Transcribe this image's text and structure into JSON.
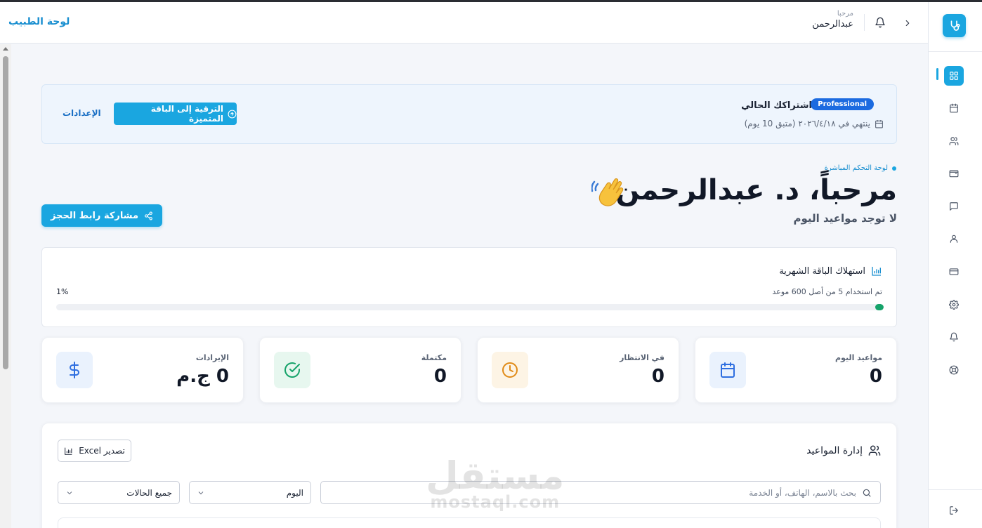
{
  "header": {
    "title": "لوحة الطبيب",
    "greeting": "مرحبا",
    "user_name": "عبدالرحمن"
  },
  "subscription": {
    "label": "اشتراكك الحالي",
    "plan_badge": "Professional",
    "expiry": "ينتهي في ٢٠٢٦/٤/١٨ (متبق 10 يوم)",
    "upgrade_label": "الترقية إلى الباقة المتميزة",
    "settings_label": "الإعدادات"
  },
  "welcome": {
    "tag": "لوحة التحكم المباشرة",
    "title": "مرحباً، د. عبدالرحمن",
    "subtitle": "لا توجد مواعيد اليوم",
    "share_label": "مشاركة رابط الحجز"
  },
  "usage": {
    "title": "استهلاك الباقة الشهرية",
    "detail": "تم استخدام 5 من أصل 600 موعد",
    "percent_label": "1%",
    "fraction": 0.01
  },
  "stats": [
    {
      "label": "مواعيد اليوم",
      "value": "0",
      "icon": "calendar-icon",
      "color": "#2f6fe0",
      "bg": "#eaf2fd"
    },
    {
      "label": "في الانتظار",
      "value": "0",
      "icon": "clock-icon",
      "color": "#e08a16",
      "bg": "#fdf4e5"
    },
    {
      "label": "مكتملة",
      "value": "0",
      "icon": "check-circle-icon",
      "color": "#16a36a",
      "bg": "#e7f7ef"
    },
    {
      "label": "الإيرادات",
      "value": "0 ج.م",
      "icon": "dollar-icon",
      "color": "#2f6fe0",
      "bg": "#eaf2fd"
    }
  ],
  "management": {
    "title": "إدارة المواعيد",
    "export_label": "تصدير Excel",
    "search_placeholder": "بحث بالاسم، الهاتف، أو الخدمة",
    "date_filter": "اليوم",
    "status_filter": "جميع الحالات"
  },
  "watermark": {
    "arabic": "مستقل",
    "latin": "mostaql.com"
  },
  "colors": {
    "accent": "#1aa6e0",
    "badge": "#1c6be0",
    "progress": "#16a36a"
  }
}
